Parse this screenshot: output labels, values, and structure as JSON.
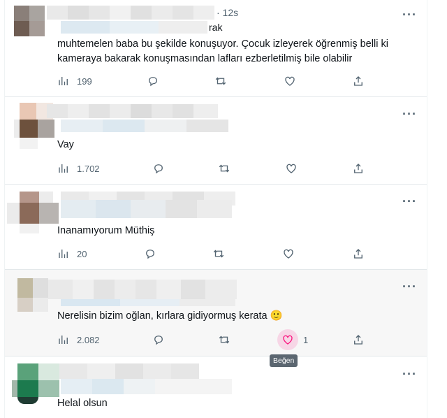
{
  "colors": {
    "icon_gray": "#536471",
    "like_pink": "#f91880",
    "like_bg": "#f7d6e6",
    "tooltip_bg": "#5b6670",
    "divider": "#e3e8ea"
  },
  "tweets": [
    {
      "time": "· 12s",
      "partial_text": "rak",
      "text": "muhtemelen baba bu şekilde konuşuyor. Çocuk izleyerek öğrenmiş belli ki\nkameraya bakarak konuşmasından lafları ezberletilmiş bile olabilir",
      "views": "199",
      "likes": ""
    },
    {
      "text": "Vay",
      "views": "1.702",
      "likes": ""
    },
    {
      "text": "Inanamıyorum Müthiş",
      "views": "20",
      "likes": ""
    },
    {
      "text": "Nerelisin bizim oğlan, kırlara gidiyormuş kerata 🙂",
      "views": "2.082",
      "likes": "1",
      "tooltip": "Beğen"
    },
    {
      "text": "Helal olsun"
    }
  ],
  "icons": {
    "more": "more-icon",
    "views": "views-icon",
    "reply": "reply-icon",
    "retweet": "retweet-icon",
    "like": "heart-icon",
    "share": "share-icon"
  }
}
